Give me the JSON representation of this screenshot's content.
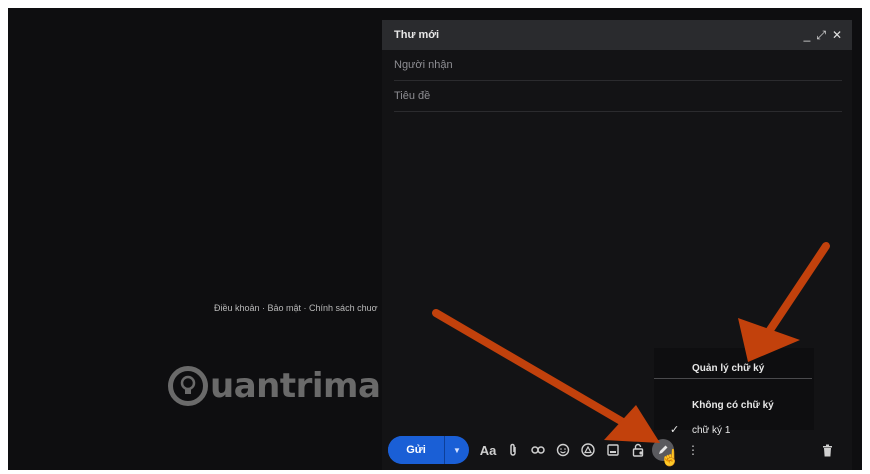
{
  "compose": {
    "title": "Thư mới",
    "recipients_placeholder": "Người nhận",
    "subject_placeholder": "Tiêu đề"
  },
  "footer": {
    "links": "Điều khoản · Bảo mật · Chính sách chuơ"
  },
  "watermark": {
    "text": "uantrimang"
  },
  "toolbar": {
    "send_label": "Gửi",
    "format_label": "Aa"
  },
  "signature_menu": {
    "manage": "Quản lý chữ ký",
    "none": "Không có chữ ký",
    "signature_1": "chữ ký 1"
  },
  "colors": {
    "send_button": "#1a5fd6",
    "annotation_arrow": "#c2410c"
  }
}
